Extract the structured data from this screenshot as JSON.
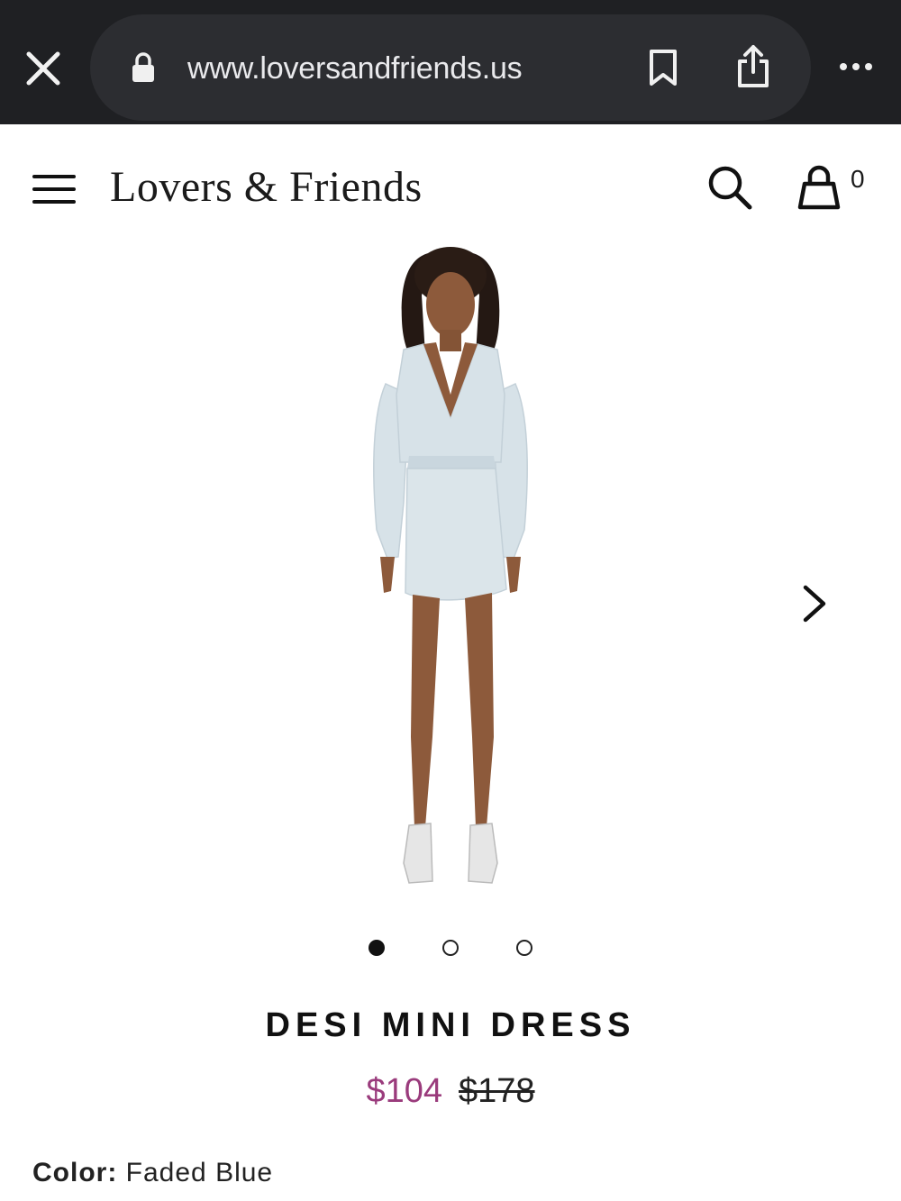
{
  "browser": {
    "url": "www.loversandfriends.us",
    "icons": [
      "close-icon",
      "lock-icon",
      "bookmark-icon",
      "share-icon",
      "more-icon"
    ]
  },
  "header": {
    "brand": "Lovers & Friends",
    "cart_count": "0",
    "icons": [
      "menu-icon",
      "search-icon",
      "bag-icon"
    ]
  },
  "gallery": {
    "total_images": 3,
    "active_index": 0,
    "next_icon": "chevron-right-icon"
  },
  "product": {
    "name": "DESI MINI DRESS",
    "sale_price": "$104",
    "original_price": "$178",
    "color_label": "Color:",
    "color_value": "Faded Blue"
  },
  "colors": {
    "browser_bar": "#1f2023",
    "url_pill": "#2c2d31",
    "sale_price": "#9a3b7c",
    "dress": "#d7e2e8"
  }
}
